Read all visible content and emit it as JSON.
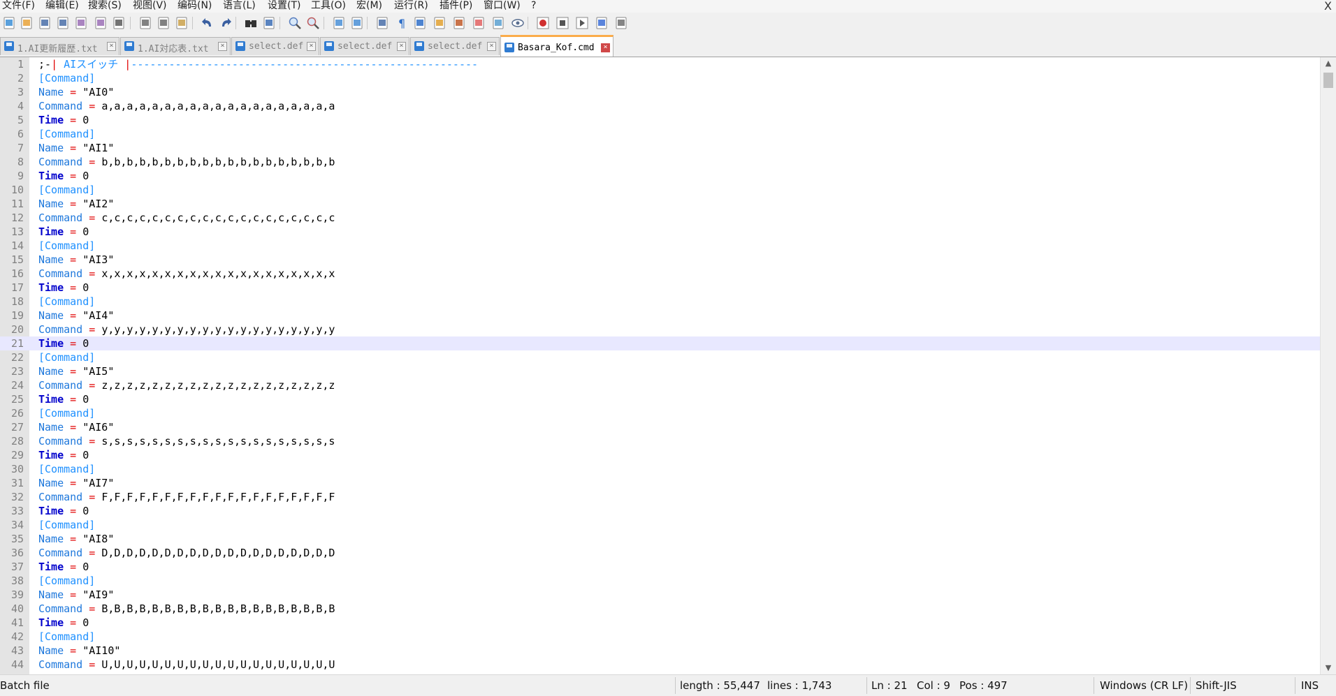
{
  "menu": {
    "items": [
      "文件(F)",
      "编辑(E)",
      "搜索(S)",
      "视图(V)",
      "编码(N)",
      "语言(L)",
      "设置(T)",
      "工具(O)",
      "宏(M)",
      "运行(R)",
      "插件(P)",
      "窗口(W)",
      "?"
    ],
    "close": "X"
  },
  "toolbar": {
    "icons": [
      "new-file-icon",
      "open-file-icon",
      "save-icon",
      "save-all-icon",
      "close-icon",
      "close-all-icon",
      "print-icon",
      "cut-icon",
      "copy-icon",
      "paste-icon",
      "undo-icon",
      "redo-icon",
      "find-icon",
      "replace-icon",
      "zoom-in-icon",
      "zoom-out-icon",
      "sync-vertical-icon",
      "sync-horizontal-icon",
      "word-wrap-icon",
      "show-all-chars-icon",
      "indent-guide-icon",
      "document-map-icon",
      "function-list-icon",
      "folder-workspace-icon",
      "monitoring-icon",
      "eye-icon",
      "record-macro-icon",
      "stop-macro-icon",
      "play-macro-icon",
      "run-macro-multiple-icon",
      "save-macro-icon"
    ]
  },
  "tabs": [
    {
      "label": "1.AI更新履歴.txt",
      "active": false
    },
    {
      "label": "1.AI対応表.txt",
      "active": false
    },
    {
      "label": "select.def",
      "active": false
    },
    {
      "label": "select.def",
      "active": false
    },
    {
      "label": "select.def",
      "active": false
    },
    {
      "label": "Basara_Kof.cmd",
      "active": true
    }
  ],
  "tab_close_glyph": "×",
  "editor": {
    "current_line": 21,
    "lines": [
      {
        "n": "1",
        "t": "comment",
        "text": ";-| AIスイッチ |-------------------------------------------------------"
      },
      {
        "n": "2",
        "t": "section",
        "text": "[Command]"
      },
      {
        "n": "3",
        "t": "name",
        "key": "Name",
        "eq": "=",
        "val": "\"AI0\""
      },
      {
        "n": "4",
        "t": "cmd",
        "key": "Command",
        "eq": "=",
        "val": "a,a,a,a,a,a,a,a,a,a,a,a,a,a,a,a,a,a,a"
      },
      {
        "n": "5",
        "t": "time",
        "key": "Time",
        "eq": "=",
        "val": "0"
      },
      {
        "n": "6",
        "t": "section",
        "text": "[Command]"
      },
      {
        "n": "7",
        "t": "name",
        "key": "Name",
        "eq": "=",
        "val": "\"AI1\""
      },
      {
        "n": "8",
        "t": "cmd",
        "key": "Command",
        "eq": "=",
        "val": "b,b,b,b,b,b,b,b,b,b,b,b,b,b,b,b,b,b,b"
      },
      {
        "n": "9",
        "t": "time",
        "key": "Time",
        "eq": "=",
        "val": "0"
      },
      {
        "n": "10",
        "t": "section",
        "text": "[Command]"
      },
      {
        "n": "11",
        "t": "name",
        "key": "Name",
        "eq": "=",
        "val": "\"AI2\""
      },
      {
        "n": "12",
        "t": "cmd",
        "key": "Command",
        "eq": "=",
        "val": "c,c,c,c,c,c,c,c,c,c,c,c,c,c,c,c,c,c,c"
      },
      {
        "n": "13",
        "t": "time",
        "key": "Time",
        "eq": "=",
        "val": "0"
      },
      {
        "n": "14",
        "t": "section",
        "text": "[Command]"
      },
      {
        "n": "15",
        "t": "name",
        "key": "Name",
        "eq": "=",
        "val": "\"AI3\""
      },
      {
        "n": "16",
        "t": "cmd",
        "key": "Command",
        "eq": "=",
        "val": "x,x,x,x,x,x,x,x,x,x,x,x,x,x,x,x,x,x,x"
      },
      {
        "n": "17",
        "t": "time",
        "key": "Time",
        "eq": "=",
        "val": "0"
      },
      {
        "n": "18",
        "t": "section",
        "text": "[Command]"
      },
      {
        "n": "19",
        "t": "name",
        "key": "Name",
        "eq": "=",
        "val": "\"AI4\""
      },
      {
        "n": "20",
        "t": "cmd",
        "key": "Command",
        "eq": "=",
        "val": "y,y,y,y,y,y,y,y,y,y,y,y,y,y,y,y,y,y,y"
      },
      {
        "n": "21",
        "t": "time",
        "key": "Time",
        "eq": "=",
        "val": "0"
      },
      {
        "n": "22",
        "t": "section",
        "text": "[Command]"
      },
      {
        "n": "23",
        "t": "name",
        "key": "Name",
        "eq": "=",
        "val": "\"AI5\""
      },
      {
        "n": "24",
        "t": "cmd",
        "key": "Command",
        "eq": "=",
        "val": "z,z,z,z,z,z,z,z,z,z,z,z,z,z,z,z,z,z,z"
      },
      {
        "n": "25",
        "t": "time",
        "key": "Time",
        "eq": "=",
        "val": "0"
      },
      {
        "n": "26",
        "t": "section",
        "text": "[Command]"
      },
      {
        "n": "27",
        "t": "name",
        "key": "Name",
        "eq": "=",
        "val": "\"AI6\""
      },
      {
        "n": "28",
        "t": "cmd",
        "key": "Command",
        "eq": "=",
        "val": "s,s,s,s,s,s,s,s,s,s,s,s,s,s,s,s,s,s,s"
      },
      {
        "n": "29",
        "t": "time",
        "key": "Time",
        "eq": "=",
        "val": "0"
      },
      {
        "n": "30",
        "t": "section",
        "text": "[Command]"
      },
      {
        "n": "31",
        "t": "name",
        "key": "Name",
        "eq": "=",
        "val": "\"AI7\""
      },
      {
        "n": "32",
        "t": "cmd",
        "key": "Command",
        "eq": "=",
        "val": "F,F,F,F,F,F,F,F,F,F,F,F,F,F,F,F,F,F,F"
      },
      {
        "n": "33",
        "t": "time",
        "key": "Time",
        "eq": "=",
        "val": "0"
      },
      {
        "n": "34",
        "t": "section",
        "text": "[Command]"
      },
      {
        "n": "35",
        "t": "name",
        "key": "Name",
        "eq": "=",
        "val": "\"AI8\""
      },
      {
        "n": "36",
        "t": "cmd",
        "key": "Command",
        "eq": "=",
        "val": "D,D,D,D,D,D,D,D,D,D,D,D,D,D,D,D,D,D,D"
      },
      {
        "n": "37",
        "t": "time",
        "key": "Time",
        "eq": "=",
        "val": "0"
      },
      {
        "n": "38",
        "t": "section",
        "text": "[Command]"
      },
      {
        "n": "39",
        "t": "name",
        "key": "Name",
        "eq": "=",
        "val": "\"AI9\""
      },
      {
        "n": "40",
        "t": "cmd",
        "key": "Command",
        "eq": "=",
        "val": "B,B,B,B,B,B,B,B,B,B,B,B,B,B,B,B,B,B,B"
      },
      {
        "n": "41",
        "t": "time",
        "key": "Time",
        "eq": "=",
        "val": "0"
      },
      {
        "n": "42",
        "t": "section",
        "text": "[Command]"
      },
      {
        "n": "43",
        "t": "name",
        "key": "Name",
        "eq": "=",
        "val": "\"AI10\""
      },
      {
        "n": "44",
        "t": "cmd",
        "key": "Command",
        "eq": "=",
        "val": "U,U,U,U,U,U,U,U,U,U,U,U,U,U,U,U,U,U,U"
      }
    ]
  },
  "scrollbar": {
    "up": "▲",
    "down": "▼"
  },
  "status": {
    "file_type": "Batch file",
    "length": "length : 55,447",
    "lines": "lines : 1,743",
    "ln": "Ln : 21",
    "col": "Col : 9",
    "pos": "Pos : 497",
    "eol": "Windows (CR LF)",
    "encoding": "Shift-JIS",
    "mode": "INS"
  },
  "colors": {
    "section": "#1e90ff",
    "key": "#1e78dc",
    "time_keyword": "#0000cc",
    "operator": "#e00000",
    "current_line_bg": "#e8e8ff",
    "active_tab_accent": "#fbac4a"
  }
}
